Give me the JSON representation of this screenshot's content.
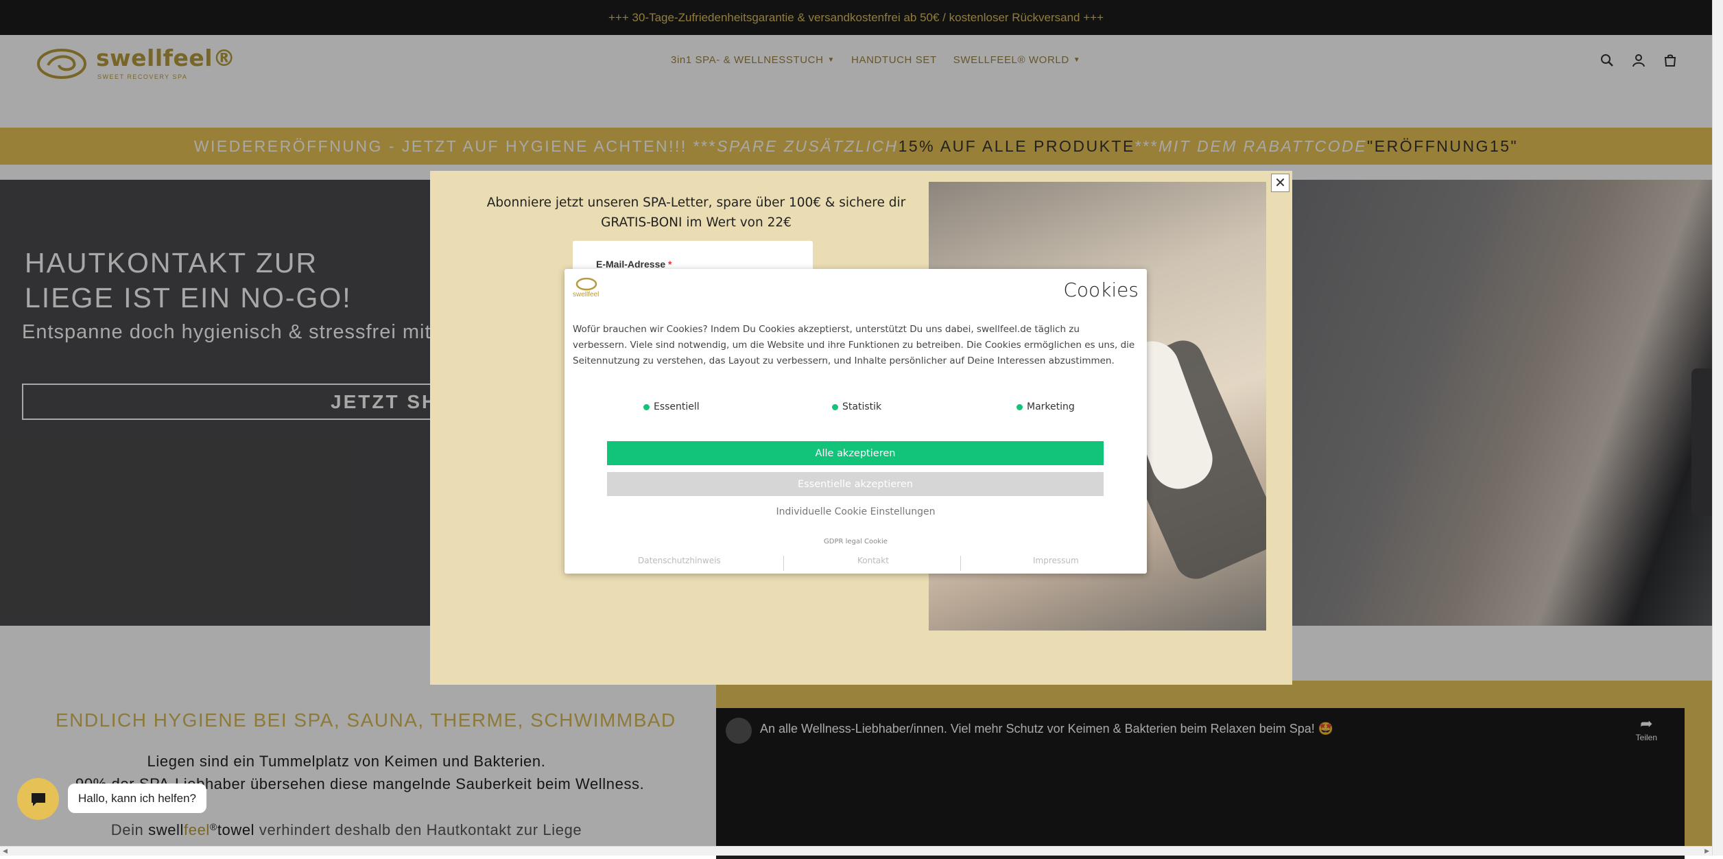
{
  "announcement": "+++ 30-Tage-Zufriedenheitsgarantie & versandkostenfrei ab 50€ / kostenloser Rückversand +++",
  "header": {
    "logo_text": "swellfeel®",
    "logo_tagline": "SWEET RECOVERY SPA",
    "nav": [
      {
        "label": "3in1 SPA- & WELLNESSTUCH",
        "dropdown": true
      },
      {
        "label": "HANDTUCH SET",
        "dropdown": false
      },
      {
        "label": "SWELLFEEL® WORLD",
        "dropdown": true
      }
    ],
    "icons": [
      "search-icon",
      "account-icon",
      "cart-icon"
    ]
  },
  "promo": {
    "part1": "WIEDERERÖFFNUNG - JETZT AUF HYGIENE ACHTEN!!! *** ",
    "part2": "SPARE ZUSÄTZLICH ",
    "part3": "15% AUF ALLE PRODUKTE",
    "part4": " *** ",
    "part5": "MIT DEM RABATTCODE ",
    "part6": "\"ERÖFFNUNG15\""
  },
  "hero": {
    "title_line1": "HAUTKONTAKT ZUR",
    "title_line2": "LIEGE IST EIN NO-GO!",
    "subtitle": "Entspanne doch hygienisch & stressfrei mit swe",
    "button": "JETZT SHO"
  },
  "section": {
    "heading": "ENDLICH HYGIENE BEI SPA, SAUNA, THERME, SCHWIMMBAD",
    "line1": "Liegen sind ein Tummelplatz von Keimen und Bakterien.",
    "line2": "90% der SPA-Liebhaber übersehen diese mangelnde Sauberkeit beim Wellness.",
    "line3_pre": "Dein ",
    "line3_brand1": "swell",
    "line3_brand2": "feel",
    "line3_reg": "®",
    "line3_towel": "towel",
    "line3_post": " verhindert deshalb den Hautkontakt zur Liege"
  },
  "video": {
    "title": "An alle Wellness-Liebhaber/innen. Viel mehr Schutz vor Keimen & Bakterien beim Relaxen beim Spa! 🤩",
    "share_label": "Teilen"
  },
  "newsletter": {
    "text": "Abonniere jetzt unseren SPA-Letter, spare über 100€ & sichere dir GRATIS-BONI im Wert von 22€",
    "email_label": "E-Mail-Adresse",
    "required_mark": "*",
    "close": "✕"
  },
  "cookie": {
    "logo_text": "swellfeel",
    "title": "Cookies",
    "description": "Wofür brauchen wir Cookies? Indem Du Cookies akzeptierst, unterstützt Du uns dabei, swellfeel.de täglich zu verbessern. Viele sind notwendig, um die Website und ihre Funktionen zu betreiben. Die Cookies ermöglichen es uns, die Seitennutzung zu verstehen, das Layout zu verbessern, und Inhalte persönlicher auf Deine Interessen abzustimmen.",
    "categories": [
      "Essentiell",
      "Statistik",
      "Marketing"
    ],
    "accept_all": "Alle akzeptieren",
    "accept_essential": "Essentielle akzeptieren",
    "individual": "Individuelle Cookie Einstellungen",
    "gdpr": "GDPR legal Cookie",
    "links": [
      "Datenschutzhinweis",
      "Kontakt",
      "Impressum"
    ],
    "accent_color": "#12c47a"
  },
  "chat": {
    "bubble": "Hallo, kann ich helfen?"
  },
  "colors": {
    "gold": "#e8c356",
    "dark": "#1c1c1c"
  }
}
